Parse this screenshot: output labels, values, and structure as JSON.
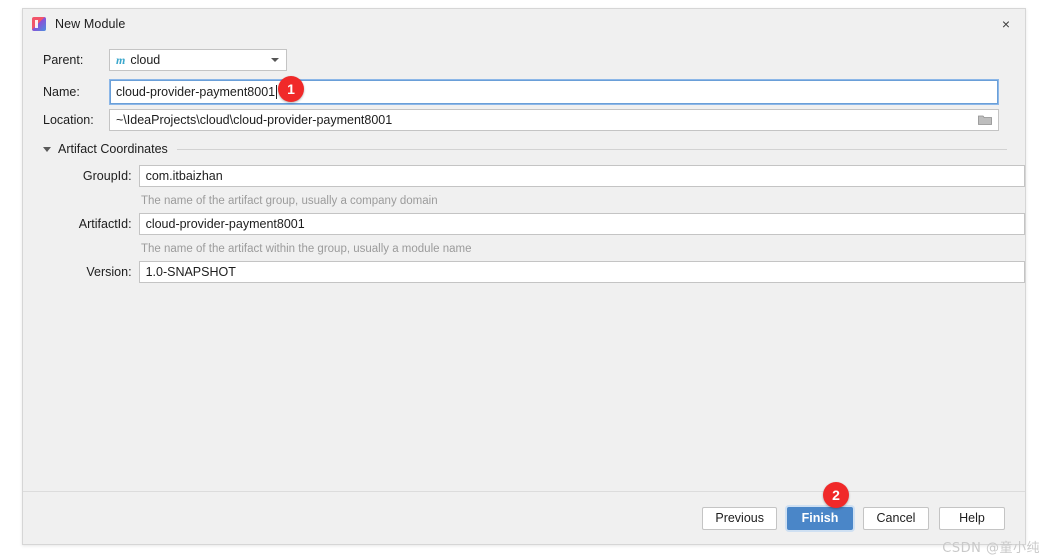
{
  "window": {
    "title": "New Module",
    "icon": "intellij-idea-icon",
    "close_label": "×"
  },
  "form": {
    "parent": {
      "label": "Parent:",
      "value": "cloud",
      "icon_glyph": "m",
      "icon_name": "maven-module-icon"
    },
    "name": {
      "label": "Name:",
      "value": "cloud-provider-payment8001"
    },
    "location": {
      "label": "Location:",
      "value": "~\\IdeaProjects\\cloud\\cloud-provider-payment8001"
    }
  },
  "artifact_section": {
    "label": "Artifact Coordinates",
    "expanded": true,
    "fields": [
      {
        "label": "GroupId:",
        "value": "com.itbaizhan",
        "hint": "The name of the artifact group, usually a company domain"
      },
      {
        "label": "ArtifactId:",
        "value": "cloud-provider-payment8001",
        "hint": "The name of the artifact within the group, usually a module name"
      },
      {
        "label": "Version:",
        "value": "1.0-SNAPSHOT",
        "hint": ""
      }
    ]
  },
  "buttons": {
    "previous": "Previous",
    "finish": "Finish",
    "cancel": "Cancel",
    "help": "Help"
  },
  "annotations": [
    {
      "id": "1",
      "target": "name-input"
    },
    {
      "id": "2",
      "target": "finish-button"
    }
  ],
  "watermark": "CSDN @童小纯",
  "colors": {
    "primary_button": "#4a86c8",
    "badge": "#f02929",
    "dialog_bg": "#f0f0f0",
    "field_border": "#c4c4c4",
    "focus_border": "#8cb7e8",
    "hint_text": "#9b9b9b",
    "maven_icon": "#3ba7cc"
  }
}
